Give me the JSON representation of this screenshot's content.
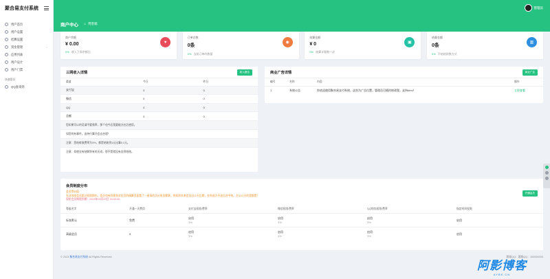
{
  "sidebar": {
    "brand": "聚合易支付系统",
    "items": [
      {
        "label": "用户首页"
      },
      {
        "label": "用户设置"
      },
      {
        "label": "结算设置"
      },
      {
        "label": "资金管理"
      },
      {
        "label": "应用列表"
      },
      {
        "label": "用户设计"
      },
      {
        "label": "用户门票"
      }
    ],
    "section_label": "快速管导",
    "section_items": [
      {
        "label": "QQ查询到"
      }
    ]
  },
  "topbar": {
    "user_name": "管理员"
  },
  "breadcrumb": {
    "page_title": "商户中心",
    "crumb": "用客端"
  },
  "cards": [
    {
      "label": "商户余额",
      "value": "¥ 0.00",
      "pct": "0%",
      "desc": "收入下周余额比",
      "color": "#e94b5b",
      "icon": "♥"
    },
    {
      "label": "订单总数",
      "value": "0条",
      "pct": "0%",
      "desc": "当前订单的数量",
      "color": "#f07b3f",
      "icon": "◉"
    },
    {
      "label": "结算金额",
      "value": "¥ 0",
      "pct": "0%",
      "desc": "结算详看数一次",
      "color": "#26c2a5",
      "icon": "▣"
    },
    {
      "label": "结算金额",
      "value": "0条",
      "pct": "0%",
      "desc": "不结结款数方式",
      "color": "#2e8fe0",
      "icon": "▥"
    }
  ],
  "income_panel": {
    "title": "三网收入详情",
    "button": "收入报告",
    "columns": [
      "渠道",
      "今日",
      "昨日"
    ],
    "rows": [
      [
        "支付宝",
        "0",
        "0"
      ],
      [
        "微信",
        "0",
        "0"
      ],
      [
        "QQ",
        "0",
        "0"
      ],
      [
        "总额",
        "0",
        "0"
      ]
    ],
    "notes": [
      "您如果可以的话请不要频率，那个也今后我要能方应后使用。",
      "如您的有事件，函持行算开会去合理！",
      "注意：您结款收费率为3%，都是结账到1元出事0.1元。",
      "注意：如使全有结解到有的天成，那不是就没有金到结账。"
    ]
  },
  "ad_panel": {
    "title": "商业广告详情",
    "button": "商业广告",
    "columns": [
      "编号",
      "名称",
      "内容",
      "操作"
    ],
    "rows": [
      {
        "no": "1",
        "name": "系统公告",
        "content": "你欢迎使用聚合易支付系统，这些为广告位置，管理员可随时修改我，支持html！",
        "action": "立即查看"
      }
    ]
  },
  "member_panel": {
    "title": "会员制度分布",
    "button": "开通会员",
    "lines": [
      {
        "text": "会员等价值",
        "cls": "c-orange"
      },
      {
        "text": "无法你成会员超过权限期内，会员也有同意到对应页的精算页面看了一星高的功分成员都联，例如你本来会员出11天后期，在你选方不选后台中结，方从11天的是都是！",
        "cls": "c-orange"
      },
      {
        "text": "现阶会员期限到期：2023年03月29日 15:00:00",
        "cls": "c-pink"
      }
    ],
    "columns": [
      "等级名字",
      "开通一天费用",
      "支付宝权限/费率",
      "微信权限/费率",
      "QQ钱包权限/费率",
      "指定时间权限"
    ],
    "rows": [
      {
        "cells": [
          "标准默认",
          "免费",
          "启用",
          "启用",
          "启用",
          "启用"
        ],
        "rates": [
          "",
          "",
          "3%",
          "3%",
          "3%",
          ""
        ]
      },
      {
        "cells": [
          "高级会员",
          "¥",
          "启用",
          "启用",
          "启用",
          "启用"
        ],
        "rates": [
          "",
          "",
          "3%",
          "3%",
          "3%",
          ""
        ]
      }
    ]
  },
  "footer": {
    "left_pre": "© 2023",
    "left_brand": "聚合易支付系统",
    "left_post": "All Rights Reserved.",
    "right": "客服QQ：客服QQ：100000000"
  },
  "watermark": {
    "main": "阿影博客",
    "sub": "AYBK.CN"
  }
}
